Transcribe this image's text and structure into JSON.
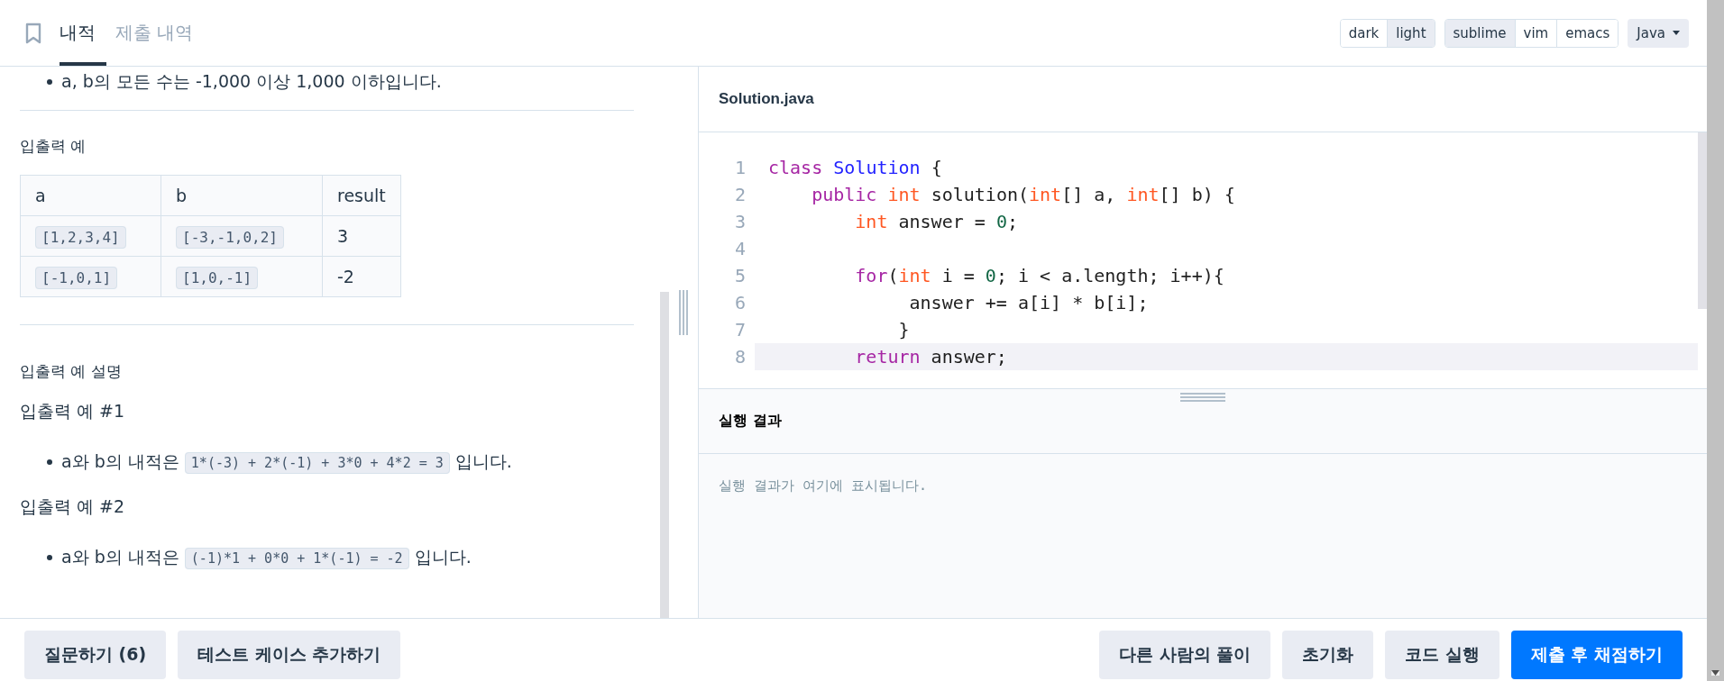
{
  "tabs": [
    {
      "label": "내적",
      "selected": true
    },
    {
      "label": "제출 내역",
      "selected": false
    }
  ],
  "theme_toggle": [
    {
      "label": "dark",
      "selected": false
    },
    {
      "label": "light",
      "selected": true
    }
  ],
  "keymap_toggle": [
    {
      "label": "sublime",
      "selected": true
    },
    {
      "label": "vim",
      "selected": false
    },
    {
      "label": "emacs",
      "selected": false
    }
  ],
  "language_dropdown": {
    "value": "Java"
  },
  "problem": {
    "constraint": "a, b의 모든 수는 -1,000 이상 1,000 이하입니다.",
    "examples_title": "입출력 예",
    "table": {
      "columns": [
        "a",
        "b",
        "result"
      ],
      "rows": [
        [
          {
            "text": "[1,2,3,4]",
            "kind": "code"
          },
          {
            "text": "[-3,-1,0,2]",
            "kind": "code"
          },
          {
            "text": "3",
            "kind": "text"
          }
        ],
        [
          {
            "text": "[-1,0,1]",
            "kind": "code"
          },
          {
            "text": "[1,0,-1]",
            "kind": "code"
          },
          {
            "text": "-2",
            "kind": "text"
          }
        ]
      ]
    },
    "explanation_title": "입출력 예 설명",
    "explanations": [
      {
        "heading": "입출력 예 #1",
        "parts": [
          {
            "text": "a와 b의 내적은",
            "kind": "text"
          },
          {
            "text": "1*(-3) + 2*(-1) + 3*0 + 4*2 = 3",
            "kind": "code"
          },
          {
            "text": "입니다.",
            "kind": "text"
          }
        ]
      },
      {
        "heading": "입출력 예 #2",
        "parts": [
          {
            "text": "a와 b의 내적은",
            "kind": "text"
          },
          {
            "text": "(-1)*1 + 0*0 + 1*(-1) = -2",
            "kind": "code"
          },
          {
            "text": "입니다.",
            "kind": "text"
          }
        ]
      }
    ]
  },
  "editor": {
    "filename": "Solution.java",
    "lines": [
      {
        "number": "1",
        "highlighted": false,
        "tokens": [
          {
            "text": "class",
            "kind": "keyword"
          },
          {
            "text": " Solution",
            "kind": "def"
          },
          {
            "text": " {",
            "kind": "plain"
          }
        ]
      },
      {
        "number": "2",
        "highlighted": false,
        "tokens": [
          {
            "text": "    public",
            "kind": "keyword"
          },
          {
            "text": " int",
            "kind": "type"
          },
          {
            "text": " solution(",
            "kind": "plain"
          },
          {
            "text": "int",
            "kind": "type"
          },
          {
            "text": "[] a, ",
            "kind": "plain"
          },
          {
            "text": "int",
            "kind": "type"
          },
          {
            "text": "[] b) {",
            "kind": "plain"
          }
        ]
      },
      {
        "number": "3",
        "highlighted": false,
        "tokens": [
          {
            "text": "        int",
            "kind": "type"
          },
          {
            "text": " answer = ",
            "kind": "plain"
          },
          {
            "text": "0",
            "kind": "number"
          },
          {
            "text": ";",
            "kind": "plain"
          }
        ]
      },
      {
        "number": "4",
        "highlighted": false
      },
      {
        "number": "5",
        "highlighted": false,
        "tokens": [
          {
            "text": "        for",
            "kind": "keyword"
          },
          {
            "text": "(",
            "kind": "plain"
          },
          {
            "text": "int",
            "kind": "type"
          },
          {
            "text": " i = ",
            "kind": "plain"
          },
          {
            "text": "0",
            "kind": "number"
          },
          {
            "text": "; i < a.length; i++){",
            "kind": "plain"
          }
        ]
      },
      {
        "number": "6",
        "highlighted": false,
        "tokens": [
          {
            "text": "             answer += a[i] * b[i];",
            "kind": "plain"
          }
        ]
      },
      {
        "number": "7",
        "highlighted": false,
        "tokens": [
          {
            "text": "            }",
            "kind": "plain"
          }
        ]
      },
      {
        "number": "8",
        "highlighted": true,
        "tokens": [
          {
            "text": "        return",
            "kind": "keyword"
          },
          {
            "text": " answer;",
            "kind": "plain"
          }
        ]
      }
    ]
  },
  "result": {
    "title": "실행 결과",
    "message": "실행 결과가 여기에 표시됩니다."
  },
  "footer": {
    "left_buttons": [
      {
        "label": "질문하기 (6)",
        "primary": false
      },
      {
        "label": "테스트 케이스 추가하기",
        "primary": false
      }
    ],
    "right_buttons": [
      {
        "label": "다른 사람의 풀이",
        "primary": false
      },
      {
        "label": "초기화",
        "primary": false
      },
      {
        "label": "코드 실행",
        "primary": false
      },
      {
        "label": "제출 후 채점하기",
        "primary": true
      }
    ]
  }
}
